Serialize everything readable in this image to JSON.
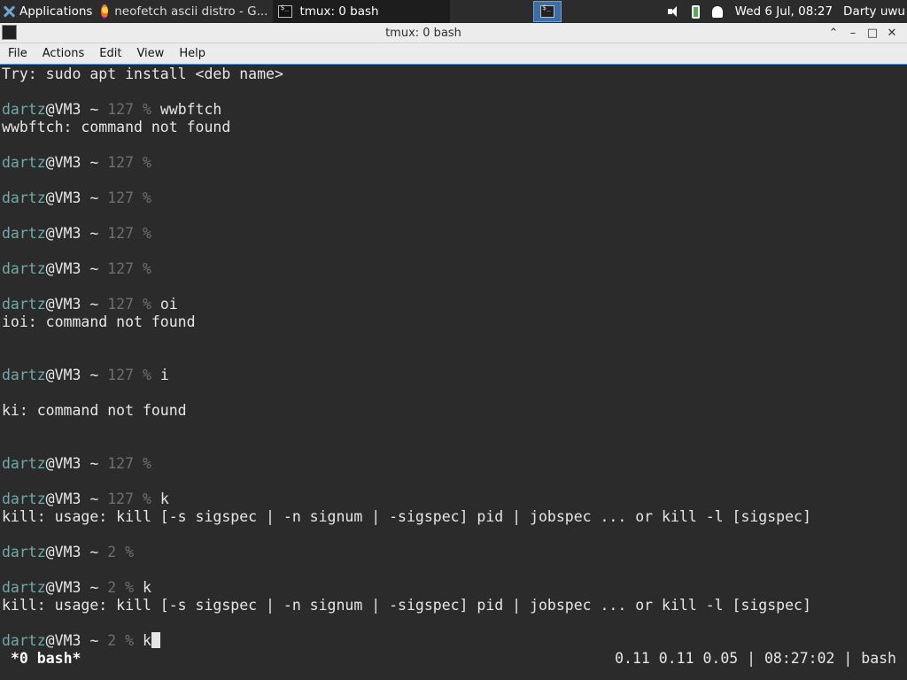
{
  "panel": {
    "apps_label": "Applications",
    "task_browser": "neofetch ascii distro - G...",
    "task_terminal": "tmux: 0 bash",
    "clock": "Wed  6 Jul, 08:27",
    "user": "Darty uwu"
  },
  "window": {
    "title": "tmux: 0 bash",
    "btn_up": "⌃",
    "btn_min": "–",
    "btn_max": "□",
    "btn_close": "✕"
  },
  "menu": {
    "file": "File",
    "actions": "Actions",
    "edit": "Edit",
    "view": "View",
    "help": "Help"
  },
  "terminal": {
    "user": "dartz",
    "host": "@VM3 ~ ",
    "l0": "Try: sudo apt install <deb name>",
    "l2": {
      "status": "127 %",
      "cmd": " wwbftch"
    },
    "l3": "wwbftch: command not found",
    "l5": {
      "status": "127 %"
    },
    "l7": {
      "status": "127 %"
    },
    "l9": {
      "status": "127 %"
    },
    "l11": {
      "status": "127 %"
    },
    "l13": {
      "status": "127 %",
      "cmd": " oi"
    },
    "l14": "ioi: command not found",
    "l17": {
      "status": "127 %",
      "cmd": " i"
    },
    "l19": "ki: command not found",
    "l22": {
      "status": "127 %"
    },
    "l24": {
      "status": "127 %",
      "cmd": " k"
    },
    "l25": "kill: usage: kill [-s sigspec | -n signum | -sigspec] pid | jobspec ... or kill -l [sigspec]",
    "l27": {
      "status": "2 %"
    },
    "l29": {
      "status": "2 %",
      "cmd": " k"
    },
    "l30": "kill: usage: kill [-s sigspec | -n signum | -sigspec] pid | jobspec ... or kill -l [sigspec]",
    "l32": {
      "status": "2 %",
      "cmd": " k"
    }
  },
  "tmux": {
    "window": "*0 bash*",
    "right": "0.11 0.11 0.05 | 08:27:02 | bash"
  },
  "colors": {
    "prompt_user": "#6fa9a9",
    "prompt_status": "#6f6f6f",
    "menu_border": "#5294e2"
  }
}
